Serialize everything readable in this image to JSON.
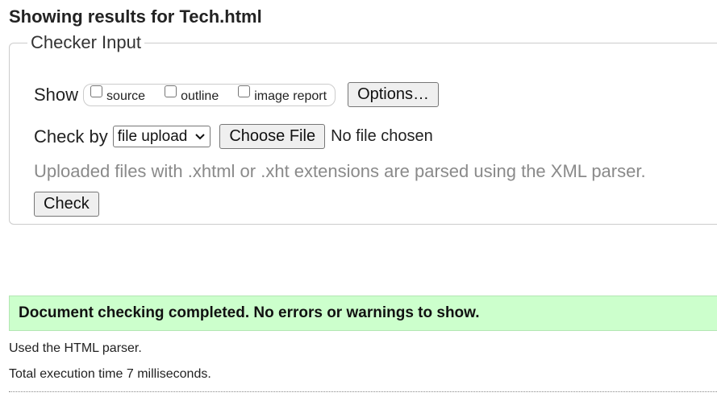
{
  "page": {
    "title": "Showing results for Tech.html"
  },
  "checker": {
    "legend": "Checker Input",
    "show_label": "Show",
    "show_options": [
      {
        "label": "source",
        "checked": false
      },
      {
        "label": "outline",
        "checked": false
      },
      {
        "label": "image report",
        "checked": false
      }
    ],
    "options_button": "Options…",
    "check_by_label": "Check by",
    "check_by_selected": "file upload",
    "choose_file_button": "Choose File",
    "file_status": "No file chosen",
    "note": "Uploaded files with .xhtml or .xht extensions are parsed using the XML parser.",
    "check_button": "Check"
  },
  "results": {
    "success_message": "Document checking completed. No errors or warnings to show.",
    "parser_info": "Used the HTML parser.",
    "execution_time": "Total execution time 7 milliseconds."
  },
  "colors": {
    "success_bg": "#ccffcc",
    "note_text": "#8a8a8a"
  }
}
